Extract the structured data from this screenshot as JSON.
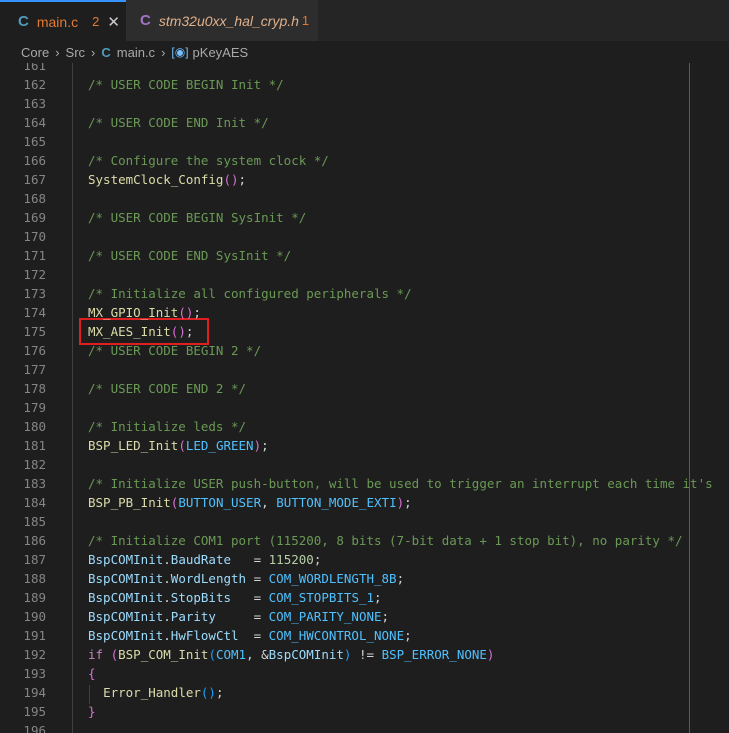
{
  "tabs": [
    {
      "icon": "C",
      "name": "main.c",
      "badge": "2",
      "close": "✕"
    },
    {
      "icon": "C",
      "name": "stm32u0xx_hal_cryp.h",
      "badge": "1"
    }
  ],
  "breadcrumbs": {
    "items": [
      "Core",
      "Src",
      "main.c",
      "pKeyAES"
    ],
    "sep": "›"
  },
  "lines": [
    {
      "n": "161",
      "html": ""
    },
    {
      "n": "162",
      "html": "<span class='cm'>/* USER CODE BEGIN Init */</span>"
    },
    {
      "n": "163",
      "html": ""
    },
    {
      "n": "164",
      "html": "<span class='cm'>/* USER CODE END Init */</span>"
    },
    {
      "n": "165",
      "html": ""
    },
    {
      "n": "166",
      "html": "<span class='cm'>/* Configure the system clock */</span>"
    },
    {
      "n": "167",
      "html": "<span class='fn'>SystemClock_Config</span><span class='pn'>()</span>;"
    },
    {
      "n": "168",
      "html": ""
    },
    {
      "n": "169",
      "html": "<span class='cm'>/* USER CODE BEGIN SysInit */</span>"
    },
    {
      "n": "170",
      "html": ""
    },
    {
      "n": "171",
      "html": "<span class='cm'>/* USER CODE END SysInit */</span>"
    },
    {
      "n": "172",
      "html": ""
    },
    {
      "n": "173",
      "html": "<span class='cm'>/* Initialize all configured peripherals */</span>"
    },
    {
      "n": "174",
      "html": "<span class='fn'>MX_GPIO_Init</span><span class='pn'>()</span>;"
    },
    {
      "n": "175",
      "html": "<span class='fn'>MX_AES_Init</span><span class='pn'>()</span>;"
    },
    {
      "n": "176",
      "html": "<span class='cm'>/* USER CODE BEGIN 2 */</span>"
    },
    {
      "n": "177",
      "html": ""
    },
    {
      "n": "178",
      "html": "<span class='cm'>/* USER CODE END 2 */</span>"
    },
    {
      "n": "179",
      "html": ""
    },
    {
      "n": "180",
      "html": "<span class='cm'>/* Initialize leds */</span>"
    },
    {
      "n": "181",
      "html": "<span class='fn'>BSP_LED_Init</span><span class='pn'>(</span><span class='cst'>LED_GREEN</span><span class='pn'>)</span>;"
    },
    {
      "n": "182",
      "html": ""
    },
    {
      "n": "183",
      "html": "<span class='cm'>/* Initialize USER push-button, will be used to trigger an interrupt each time it's</span>"
    },
    {
      "n": "184",
      "html": "<span class='fn'>BSP_PB_Init</span><span class='pn'>(</span><span class='cst'>BUTTON_USER</span>, <span class='cst'>BUTTON_MODE_EXTI</span><span class='pn'>)</span>;"
    },
    {
      "n": "185",
      "html": ""
    },
    {
      "n": "186",
      "html": "<span class='cm'>/* Initialize COM1 port (115200, 8 bits (7-bit data + 1 stop bit), no parity */</span>"
    },
    {
      "n": "187",
      "html": "<span class='var'>BspCOMInit</span>.<span class='var'>BaudRate</span>   = <span class='num'>115200</span>;"
    },
    {
      "n": "188",
      "html": "<span class='var'>BspCOMInit</span>.<span class='var'>WordLength</span> = <span class='cst'>COM_WORDLENGTH_8B</span>;"
    },
    {
      "n": "189",
      "html": "<span class='var'>BspCOMInit</span>.<span class='var'>StopBits</span>   = <span class='cst'>COM_STOPBITS_1</span>;"
    },
    {
      "n": "190",
      "html": "<span class='var'>BspCOMInit</span>.<span class='var'>Parity</span>     = <span class='cst'>COM_PARITY_NONE</span>;"
    },
    {
      "n": "191",
      "html": "<span class='var'>BspCOMInit</span>.<span class='var'>HwFlowCtl</span>  = <span class='cst'>COM_HWCONTROL_NONE</span>;"
    },
    {
      "n": "192",
      "html": "<span class='kw'>if</span> <span class='pn'>(</span><span class='fn'>BSP_COM_Init</span><span class='pb'>(</span><span class='cst'>COM1</span>, &amp;<span class='var'>BspCOMInit</span><span class='pb'>)</span> != <span class='cst'>BSP_ERROR_NONE</span><span class='pn'>)</span>"
    },
    {
      "n": "193",
      "html": "<span class='pn'>{</span>"
    },
    {
      "n": "194",
      "html": "  <span class='fn'>Error_Handler</span><span class='pb'>()</span>;"
    },
    {
      "n": "195",
      "html": "<span class='pn'>}</span>"
    },
    {
      "n": "196",
      "html": ""
    }
  ],
  "colors": {
    "background": "#1e1e1e",
    "comment": "#6a9955",
    "function": "#dcdcaa",
    "constant": "#4fc1ff",
    "highlight_box": "#e02020"
  }
}
